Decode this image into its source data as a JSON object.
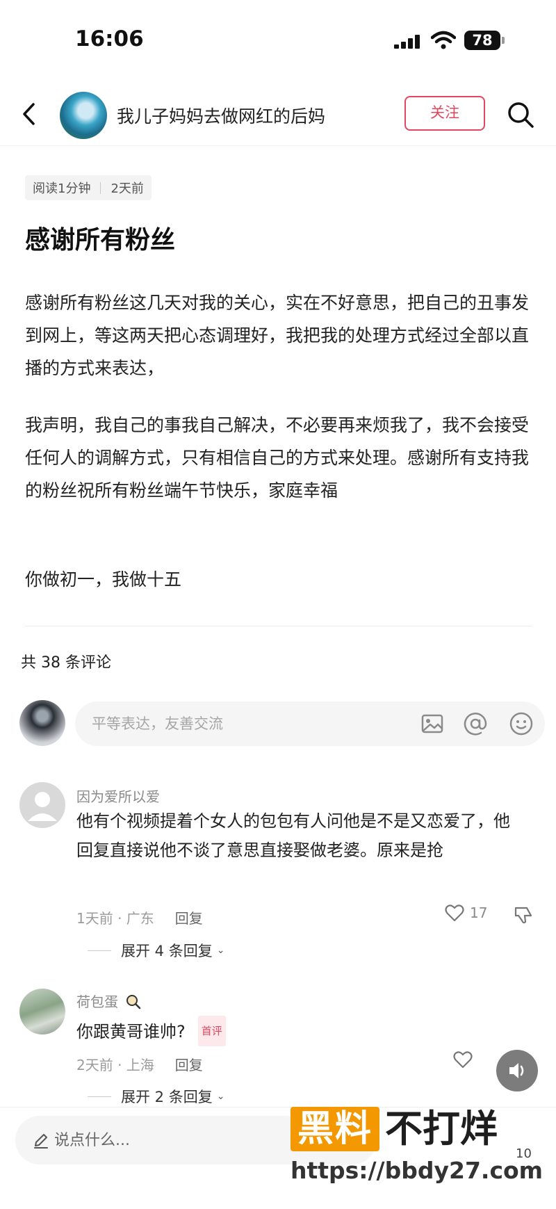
{
  "status_bar": {
    "time": "16:06",
    "battery": "78"
  },
  "nav": {
    "title": "我儿子妈妈去做网红的后妈",
    "follow_label": "关注"
  },
  "article": {
    "read_time": "阅读1分钟",
    "posted": "2天前",
    "title": "感谢所有粉丝",
    "paragraphs": [
      "感谢所有粉丝这几天对我的关心，实在不好意思，把自己的丑事发到网上，等这两天把心态调理好，我把我的处理方式经过全部以直播的方式来表达，",
      "我声明，我自己的事我自己解决，不必要再来烦我了，我不会接受任何人的调解方式，只有相信自己的方式来处理。感谢所有支持我的粉丝祝所有粉丝端午节快乐，家庭幸福",
      "你做初一，我做十五"
    ]
  },
  "comments_section": {
    "count_label": "共 38 条评论",
    "input_placeholder": "平等表达，友善交流",
    "comments": [
      {
        "author": "因为爱所以爱",
        "text": "他有个视频提着个女人的包包有人问他是不是又恋爱了，他回复直接说他不谈了意思直接娶做老婆。原来是抢",
        "time_location": "1天前 · 广东",
        "reply_label": "回复",
        "likes": "17",
        "expand_label": "展开 4 条回复"
      },
      {
        "author": "荷包蛋",
        "text": "你跟黄哥谁帅?",
        "badge": "首评",
        "time_location": "2天前 · 上海",
        "reply_label": "回复",
        "expand_label": "展开 2 条回复"
      }
    ]
  },
  "bottom_bar": {
    "placeholder": "说点什么...",
    "count": "10"
  },
  "watermark": {
    "box_text": "黑料",
    "text": "不打烊",
    "url": "https://bbdy27.com"
  },
  "colors": {
    "accent": "#e0475f",
    "watermark_orange": "#f39800",
    "muted_text": "#8a8a8a"
  }
}
